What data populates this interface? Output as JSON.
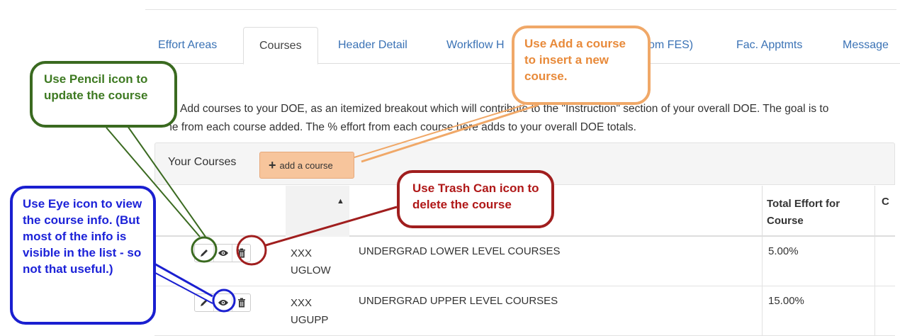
{
  "tabs": [
    {
      "label": "Effort Areas"
    },
    {
      "label": "Courses",
      "active": true
    },
    {
      "label": "Header Detail"
    },
    {
      "label": "Workflow H"
    },
    {
      "label": "om FES)"
    },
    {
      "label": "Fac. Apptmts"
    },
    {
      "label": "Message"
    }
  ],
  "intro": {
    "line1": "Add courses to your DOE, as an itemized breakout which will contribute to the \"Instruction\" section of your overall DOE. The goal is to",
    "line2": "me from each course added. The % effort from each course here adds to your overall DOE totals."
  },
  "panel": {
    "title": "Your Courses",
    "add_button": "add a course",
    "add_icon": "plus-icon"
  },
  "table": {
    "sort_indicator": "▲",
    "headers": {
      "effort": "Total Effort for Course",
      "last": "C"
    },
    "rows": [
      {
        "code": "XXX UGLOW",
        "name": "UNDERGRAD LOWER LEVEL COURSES",
        "effort": "5.00%"
      },
      {
        "code": "XXX UGUPP",
        "name": "UNDERGRAD UPPER LEVEL COURSES",
        "effort": "15.00%"
      }
    ],
    "row_icons": [
      "pencil-icon",
      "eye-icon",
      "trash-icon"
    ]
  },
  "callouts": {
    "green": "Use Pencil icon to update the course",
    "orange": "Use Add a course to insert a new course.",
    "red": "Use Trash Can icon to delete the course",
    "blue": "Use Eye icon to view the course info.  (But most of the info is visible in the list - so not that useful.)"
  },
  "colors": {
    "tab_link": "#3a72b5",
    "add_button_bg": "#f7c59c",
    "callout_green": "#3a6a20",
    "callout_orange": "#f0a868",
    "callout_red": "#a01e1e",
    "callout_blue": "#1a1fd0"
  }
}
